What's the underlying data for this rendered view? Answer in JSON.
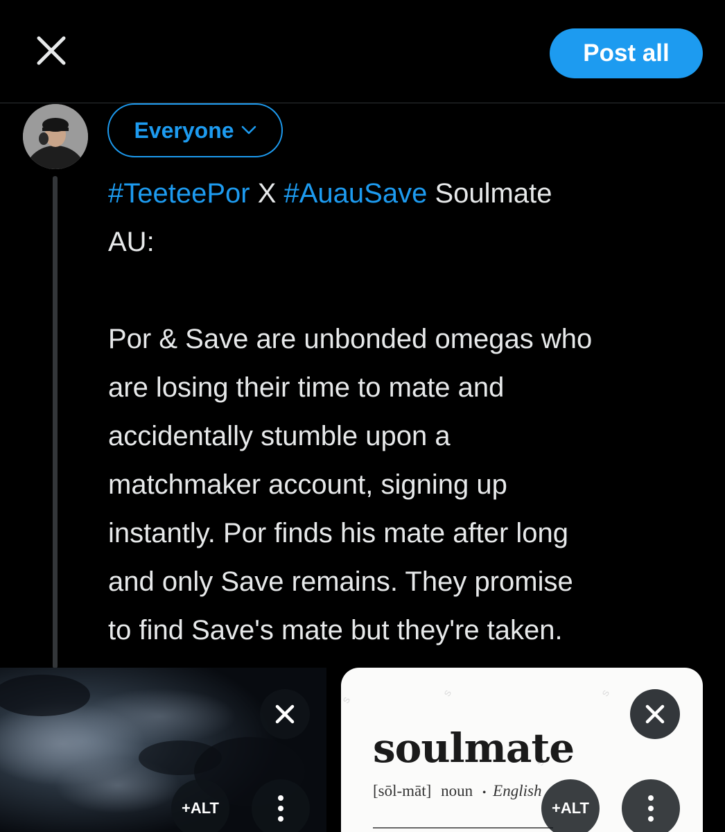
{
  "header": {
    "close_icon": "close-icon",
    "post_all_label": "Post all",
    "accent_color": "#1d9bf0"
  },
  "composer": {
    "audience_label": "Everyone",
    "tweet": {
      "hashtag1": "#TeeteePor",
      "connector": " X ",
      "hashtag2": "#AuauSave",
      "line1_rest": " Soulmate",
      "line2": "AU:",
      "para": [
        "Por & Save are unbonded omegas who",
        "are losing their time to mate and",
        "accidentally stumble upon a",
        "matchmaker account, signing up",
        "instantly. Por finds his mate after long",
        "and only Save remains. They promise",
        "to find Save's mate but they're taken."
      ]
    }
  },
  "media": [
    {
      "alt_label": "+ALT"
    },
    {
      "alt_label": "+ALT",
      "image_text": {
        "word": "soulmate",
        "pronunciation": "[sōl-māt]",
        "part_of_speech": "noun",
        "bullet": "•",
        "language": "English"
      }
    }
  ]
}
